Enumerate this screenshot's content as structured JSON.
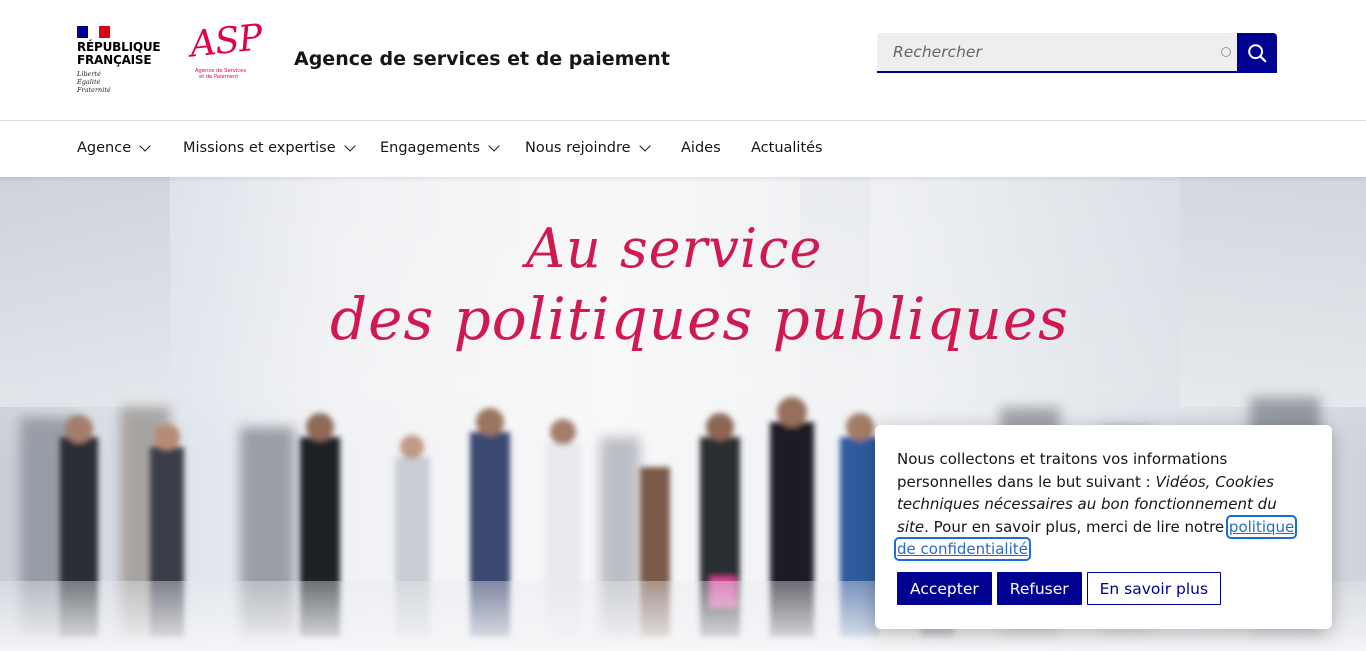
{
  "header": {
    "republique_line1": "RÉPUBLIQUE",
    "republique_line2": "FRANÇAISE",
    "devise_1": "Liberté",
    "devise_2": "Égalité",
    "devise_3": "Fraternité",
    "asp_mark": "ASP",
    "asp_sub_1": "Agence de Services",
    "asp_sub_2": "et de Paiement",
    "site_title": "Agence de services et de paiement",
    "search_placeholder": "Rechercher",
    "colors": {
      "blue_france": "#000091",
      "asp_pink": "#e1004e"
    }
  },
  "nav": {
    "items": [
      {
        "label": "Agence",
        "has_dropdown": true
      },
      {
        "label": "Missions et expertise",
        "has_dropdown": true
      },
      {
        "label": "Engagements",
        "has_dropdown": true
      },
      {
        "label": "Nous rejoindre",
        "has_dropdown": true
      },
      {
        "label": "Aides",
        "has_dropdown": false
      },
      {
        "label": "Actualités",
        "has_dropdown": false
      }
    ]
  },
  "hero": {
    "line1": "Au service",
    "line2": "des politiques publiques",
    "text_color": "#d0194f"
  },
  "cookie_banner": {
    "text_1": "Nous collectons et traitons vos informations personnelles dans le but suivant : ",
    "text_purposes": "Vidéos, Cookies techniques nécessaires au bon fonctionnement du site",
    "text_2": ". Pour en savoir plus, merci de lire notre ",
    "link_label": "politique de confidentialité",
    "text_3": ".",
    "accept_label": "Accepter",
    "refuse_label": "Refuser",
    "more_label": "En savoir plus"
  }
}
